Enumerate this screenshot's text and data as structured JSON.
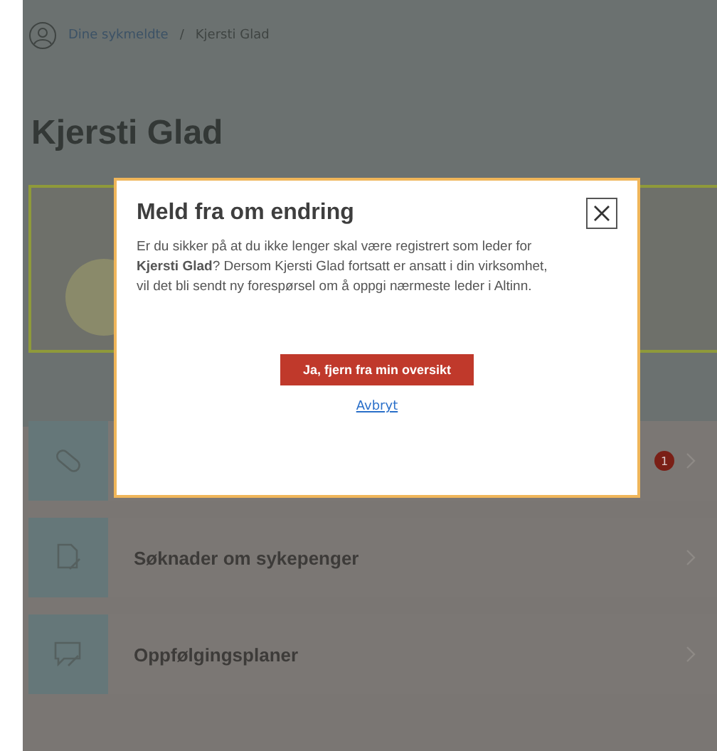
{
  "breadcrumb": [
    {
      "label": "Dine sykmeldte",
      "kind": "link"
    },
    {
      "label": "/",
      "kind": "separator"
    },
    {
      "label": "Kjersti Glad",
      "kind": "current"
    }
  ],
  "title": "Kjersti Glad",
  "rows": [
    {
      "kind": "bandage",
      "badge": "1"
    },
    {
      "kind": "document",
      "label": "Søknader om sykepenger"
    },
    {
      "kind": "chat",
      "label": "Oppfølgingsplaner"
    }
  ],
  "dialog": {
    "title": "Meld fra om endring",
    "text": "Er du sikker på at du ikke lenger skal være registrert som leder for **Kjersti Glad**? Dersom Kjersti Glad fortsatt er ansatt i din virksomhet, vil det bli sendt ny forespørsel om å oppgi nærmeste leder i Altinn.",
    "confirm": "Ja, fjern fra min oversikt",
    "cancel": "Avbryt"
  }
}
